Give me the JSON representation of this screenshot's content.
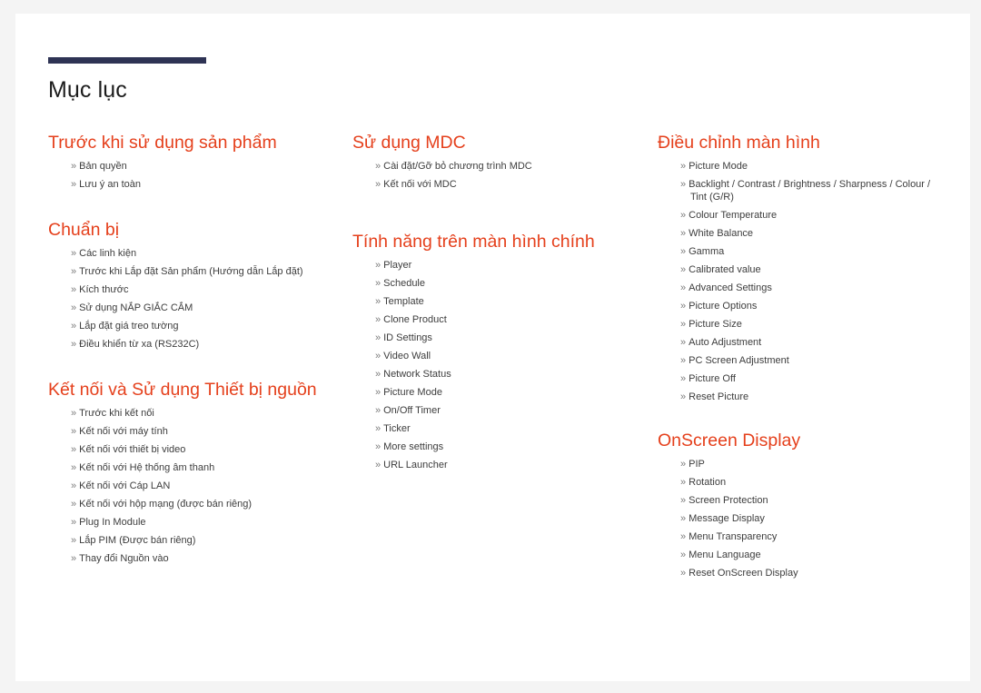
{
  "page": {
    "title": "Mục lục",
    "accent_rule_color": "#2e3354",
    "heading_color": "#e5401c",
    "body_text_color": "#3d3d3d",
    "page_background": "#ffffff",
    "canvas_background": "#f4f4f4",
    "bullet_glyph": "»"
  },
  "columns": [
    {
      "name": "column-1",
      "sections": [
        {
          "heading": "Trước khi sử dụng sản phẩm",
          "items": [
            "Bản quyền",
            "Lưu ý an toàn"
          ]
        },
        {
          "heading": "Chuẩn bị",
          "items": [
            "Các linh kiện",
            "Trước khi Lắp đặt Sản phẩm (Hướng dẫn Lắp đặt)",
            "Kích thước",
            "Sử dụng NẮP GIẮC CẮM",
            "Lắp đặt giá treo tường",
            "Điều khiển từ xa (RS232C)"
          ]
        },
        {
          "heading": "Kết nối và Sử dụng Thiết bị nguồn",
          "items": [
            "Trước khi kết nối",
            "Kết nối với máy tính",
            "Kết nối với thiết bị video",
            "Kết nối với Hệ thống âm thanh",
            "Kết nối với Cáp LAN",
            "Kết nối với hộp mạng (được bán riêng)",
            "Plug In Module",
            "Lắp PIM (Được bán riêng)",
            "Thay đổi Nguồn vào"
          ]
        }
      ]
    },
    {
      "name": "column-2",
      "sections": [
        {
          "heading": "Sử dụng MDC",
          "items": [
            "Cài đặt/Gỡ bỏ chương trình MDC",
            "Kết nối với MDC"
          ]
        },
        {
          "heading": "Tính năng trên màn hình chính",
          "items": [
            "Player",
            "Schedule",
            "Template",
            "Clone Product",
            "ID Settings",
            "Video Wall",
            "Network Status",
            "Picture Mode",
            "On/Off Timer",
            "Ticker",
            "More settings",
            "URL Launcher"
          ]
        }
      ]
    },
    {
      "name": "column-3",
      "sections": [
        {
          "heading": "Điều chỉnh màn hình",
          "items": [
            "Picture Mode",
            "Backlight / Contrast / Brightness / Sharpness / Colour / Tint (G/R)",
            "Colour Temperature",
            "White Balance",
            "Gamma",
            "Calibrated value",
            "Advanced Settings",
            "Picture Options",
            "Picture Size",
            "Auto Adjustment",
            "PC Screen Adjustment",
            "Picture Off",
            "Reset Picture"
          ]
        },
        {
          "heading": "OnScreen Display",
          "items": [
            "PIP",
            "Rotation",
            "Screen Protection",
            "Message Display",
            "Menu Transparency",
            "Menu Language",
            "Reset OnScreen Display"
          ]
        }
      ]
    }
  ]
}
